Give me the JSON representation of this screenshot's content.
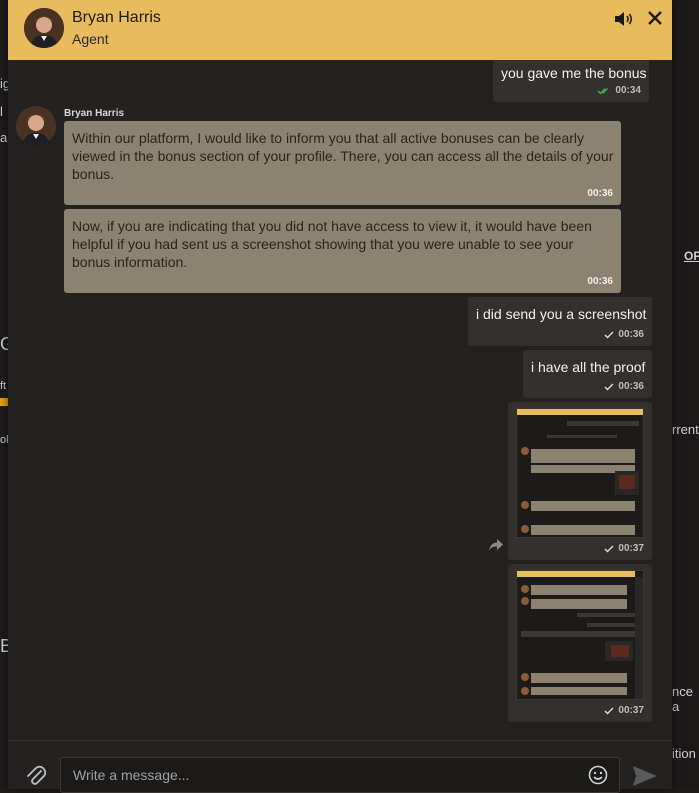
{
  "header": {
    "agent_name": "Bryan Harris",
    "agent_role": "Agent",
    "icons": [
      "speaker-icon",
      "close-icon"
    ]
  },
  "background_fragments": {
    "left": [
      "ig",
      "l",
      "ar",
      "G",
      "ft",
      "ole",
      "B"
    ],
    "right": [
      "OP",
      "rrent",
      "nce a",
      "ition"
    ]
  },
  "messages": [
    {
      "direction": "out",
      "text": "you gave me the bonus",
      "time": "00:34",
      "status": "read"
    },
    {
      "direction": "in",
      "sender": "Bryan Harris",
      "text": "Within our platform, I would like to inform you that all active bonuses can be clearly viewed in the bonus section of your profile. There, you can access all the details of your bonus.",
      "time": "00:36"
    },
    {
      "direction": "in",
      "text": "Now, if you are indicating that you did not have access to view it, it would have been helpful if you had sent us a screenshot showing that you were unable to see your bonus information.",
      "time": "00:36"
    },
    {
      "direction": "out",
      "text": "i did send you a screenshot",
      "time": "00:36",
      "status": "sent"
    },
    {
      "direction": "out",
      "text": "i have all the proof",
      "time": "00:36",
      "status": "sent"
    },
    {
      "direction": "out",
      "type": "image",
      "time": "00:37",
      "status": "sent"
    },
    {
      "direction": "out",
      "type": "image",
      "time": "00:37",
      "status": "sent"
    }
  ],
  "composer": {
    "placeholder": "Write a message..."
  },
  "colors": {
    "header_bg": "#e8bb5c",
    "incoming_bubble": "#8c8270",
    "outgoing_bubble": "#33302e",
    "read_check": "#39b54a"
  }
}
